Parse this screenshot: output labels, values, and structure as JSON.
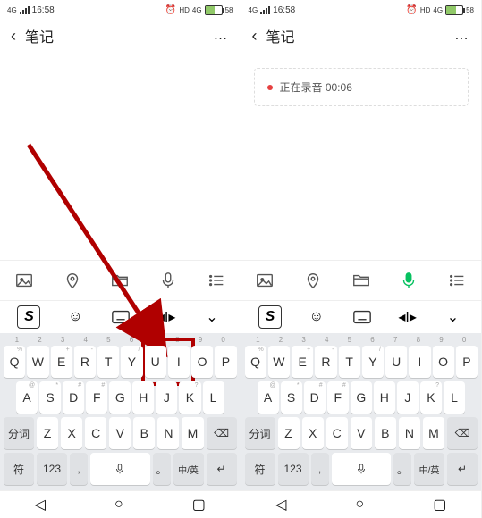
{
  "status": {
    "net": "4G",
    "time": "16:58",
    "hd": "HD",
    "batt": "58"
  },
  "header": {
    "title": "笔记",
    "back": "‹",
    "more": "…"
  },
  "record": {
    "text": "正在录音 00:06"
  },
  "toolbar": {
    "image": "image-icon",
    "location": "location-icon",
    "folder": "folder-icon",
    "mic": "mic-icon",
    "list": "list-icon"
  },
  "kb": {
    "nums": [
      "1",
      "2",
      "3",
      "4",
      "5",
      "6",
      "7",
      "8",
      "9",
      "0"
    ],
    "row1": [
      "Q",
      "W",
      "E",
      "R",
      "T",
      "Y",
      "U",
      "I",
      "O",
      "P"
    ],
    "sup1": [
      "%",
      "",
      "+",
      "-",
      "",
      "/",
      "",
      "",
      "",
      ""
    ],
    "row2": [
      "A",
      "S",
      "D",
      "F",
      "G",
      "H",
      "J",
      "K",
      "L"
    ],
    "sup2": [
      "@",
      "*",
      "#",
      "#",
      "",
      "",
      "",
      "?",
      ""
    ],
    "row3": [
      "Z",
      "X",
      "C",
      "V",
      "B",
      "N",
      "M"
    ],
    "seg": "分词",
    "del": "⌫",
    "sym": "符",
    "num": "123",
    "comma": ",",
    "period": "。",
    "lang": "中/英",
    "enter": "↵"
  },
  "nav": {
    "back": "◁",
    "home": "○",
    "recent": "▢"
  }
}
